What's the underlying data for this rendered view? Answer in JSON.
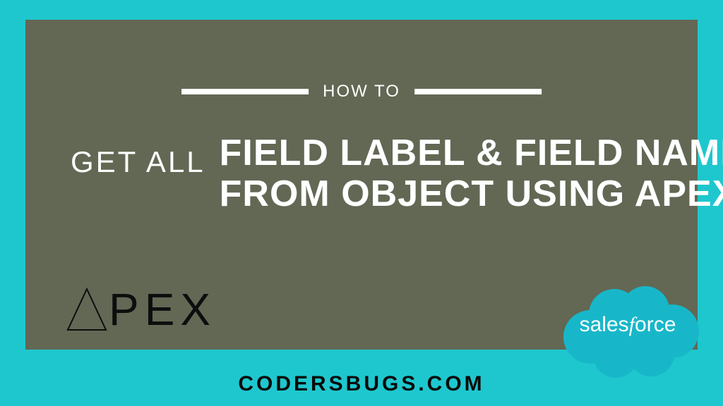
{
  "kicker": "HOW TO",
  "subhead": "GET ALL",
  "headline": {
    "line1": "FIELD LABEL & FIELD NAME",
    "line2": "FROM OBJECT USING APEX"
  },
  "apex_letters": [
    "P",
    "E",
    "X"
  ],
  "salesforce_label_pre": "sales",
  "salesforce_label_mid": "f",
  "salesforce_label_post": "orce",
  "site": "CODERSBUGS.COM",
  "colors": {
    "outer": "#1ec7ce",
    "inner": "#626854",
    "text_light": "#ffffff",
    "text_dark": "#0a0a0a",
    "cloud": "#17b7c9"
  }
}
